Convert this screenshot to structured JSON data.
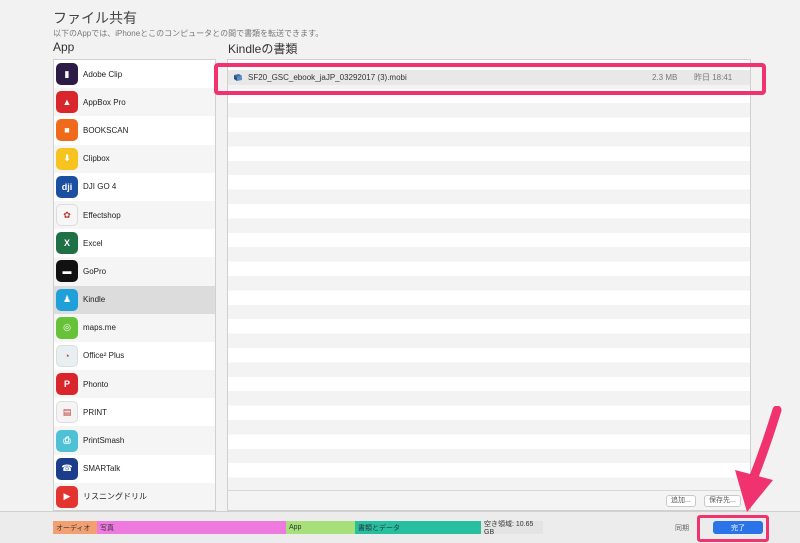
{
  "header": {
    "title": "ファイル共有",
    "description": "以下のAppでは、iPhoneとこのコンピュータとの間で書類を転送できます。"
  },
  "apps_header": "App",
  "docs_header": "Kindleの書類",
  "apps": [
    {
      "label": "Adobe Clip",
      "icon": "adobe-clip-icon",
      "color": "#2b1b45",
      "glyph": "▮"
    },
    {
      "label": "AppBox Pro",
      "icon": "appbox-pro-icon",
      "color": "#d8262c",
      "glyph": "▲"
    },
    {
      "label": "BOOKSCAN",
      "icon": "bookscan-icon",
      "color": "#f06a1b",
      "glyph": "■"
    },
    {
      "label": "Clipbox",
      "icon": "clipbox-icon",
      "color": "#f7c31f",
      "glyph": "⬇"
    },
    {
      "label": "DJI GO 4",
      "icon": "dji-go-icon",
      "color": "#1b4fa0",
      "glyph": "dji"
    },
    {
      "label": "Effectshop",
      "icon": "effectshop-icon",
      "color": "#f6f6f6",
      "glyph": "✿"
    },
    {
      "label": "Excel",
      "icon": "excel-icon",
      "color": "#1f7044",
      "glyph": "X"
    },
    {
      "label": "GoPro",
      "icon": "gopro-icon",
      "color": "#111111",
      "glyph": "▬"
    },
    {
      "label": "Kindle",
      "icon": "kindle-icon",
      "color": "#1fa0d8",
      "glyph": "♟"
    },
    {
      "label": "maps.me",
      "icon": "maps-me-icon",
      "color": "#67c23a",
      "glyph": "◎"
    },
    {
      "label": "Office² Plus",
      "icon": "office-plus-icon",
      "color": "#e9eef2",
      "glyph": "◔"
    },
    {
      "label": "Phonto",
      "icon": "phonto-icon",
      "color": "#d9262c",
      "glyph": "P"
    },
    {
      "label": "PRINT",
      "icon": "canon-print-icon",
      "color": "#f4f4f4",
      "glyph": "▤"
    },
    {
      "label": "PrintSmash",
      "icon": "printsmash-icon",
      "color": "#4ec2d4",
      "glyph": "⎙"
    },
    {
      "label": "SMARTalk",
      "icon": "smartalk-icon",
      "color": "#1c3d8a",
      "glyph": "☎"
    },
    {
      "label": "リスニングドリル",
      "icon": "listening-drill-icon",
      "color": "#e3342f",
      "glyph": "▶"
    }
  ],
  "selected_app": "Kindle",
  "file": {
    "name": "SF20_GSC_ebook_jaJP_03292017 (3).mobi",
    "size": "2.3 MB",
    "date": "昨日 18:41"
  },
  "footer_buttons": {
    "add": "追加...",
    "save_to": "保存先..."
  },
  "storage": [
    {
      "label": "オーディオ",
      "color": "#f2a071",
      "fraction": 0.073
    },
    {
      "label": "写真",
      "color": "#ee7ae0",
      "fraction": 0.313
    },
    {
      "label": "App",
      "color": "#a7e07a",
      "fraction": 0.114
    },
    {
      "label": "書類とデータ",
      "color": "#26bf9f",
      "fraction": 0.208
    },
    {
      "label": "空き領域: 10.65 GB",
      "color": "#e4e4e4",
      "fraction": 0.102
    }
  ],
  "sync_label": "同期",
  "done_label": "完了",
  "colors": {
    "highlight": "#f0326f",
    "accent": "#2b73e8"
  }
}
